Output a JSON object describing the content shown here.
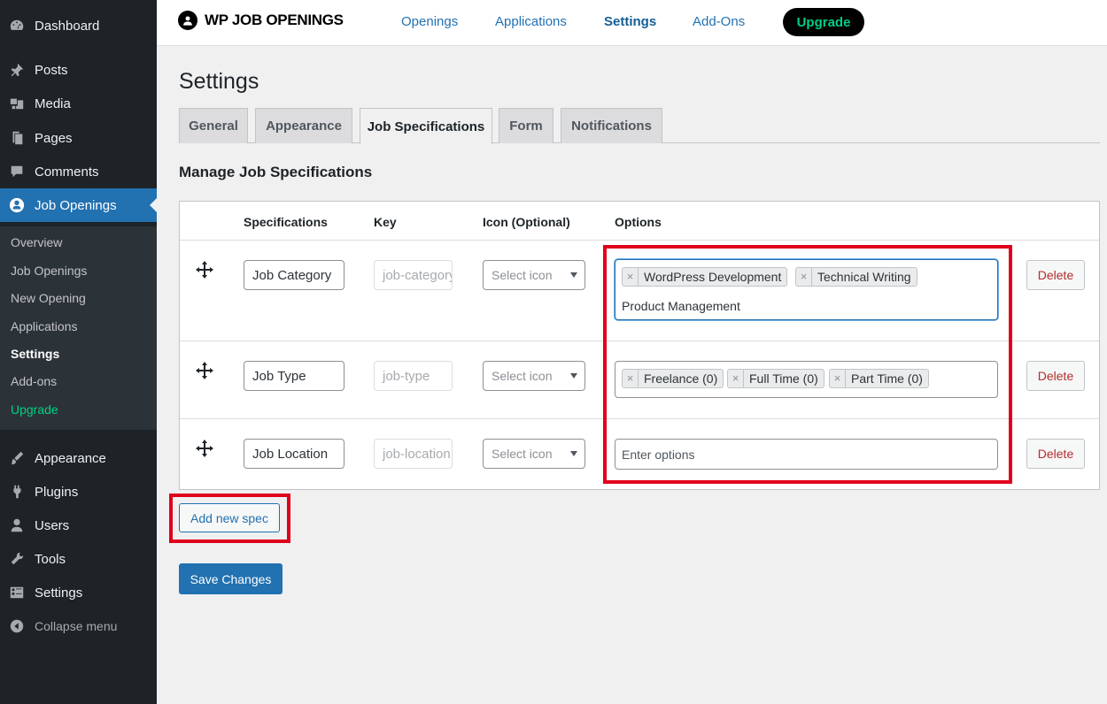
{
  "sidebar": {
    "items": [
      {
        "label": "Dashboard",
        "icon": "dashboard-icon"
      },
      {
        "label": "Posts",
        "icon": "pin-icon"
      },
      {
        "label": "Media",
        "icon": "media-icon"
      },
      {
        "label": "Pages",
        "icon": "pages-icon"
      },
      {
        "label": "Comments",
        "icon": "comment-icon"
      },
      {
        "label": "Job Openings",
        "icon": "job-openings-icon"
      },
      {
        "label": "Appearance",
        "icon": "paintbrush-icon"
      },
      {
        "label": "Plugins",
        "icon": "plugin-icon"
      },
      {
        "label": "Users",
        "icon": "user-icon"
      },
      {
        "label": "Tools",
        "icon": "wrench-icon"
      },
      {
        "label": "Settings",
        "icon": "settings-icon"
      }
    ],
    "submenu": [
      "Overview",
      "Job Openings",
      "New Opening",
      "Applications",
      "Settings",
      "Add-ons",
      "Upgrade"
    ],
    "collapse": "Collapse menu"
  },
  "topbar": {
    "logo_text": "WP JOB OPENINGS",
    "nav": [
      "Openings",
      "Applications",
      "Settings",
      "Add-Ons"
    ],
    "upgrade": "Upgrade"
  },
  "page": {
    "title": "Settings",
    "tabs": [
      "General",
      "Appearance",
      "Job Specifications",
      "Form",
      "Notifications"
    ],
    "section_title": "Manage Job Specifications"
  },
  "table": {
    "headers": [
      "Specifications",
      "Key",
      "Icon (Optional)",
      "Options"
    ],
    "rows": [
      {
        "spec": "Job Category",
        "key": "job-category",
        "icon": "Select icon",
        "chips": [
          "WordPress Development",
          "Technical Writing"
        ],
        "typed": "Product Management",
        "delete": "Delete"
      },
      {
        "spec": "Job Type",
        "key": "job-type",
        "icon": "Select icon",
        "chips": [
          "Freelance (0)",
          "Full Time (0)",
          "Part Time (0)"
        ],
        "delete": "Delete"
      },
      {
        "spec": "Job Location",
        "key": "job-location",
        "icon": "Select icon",
        "placeholder": "Enter options",
        "delete": "Delete"
      }
    ]
  },
  "buttons": {
    "add_new": "Add new spec",
    "save": "Save Changes"
  },
  "colors": {
    "sidebar_bg": "#1d2327",
    "active_menu": "#2271b1",
    "highlight": "#e0001b",
    "upgrade_green": "#00d084"
  }
}
